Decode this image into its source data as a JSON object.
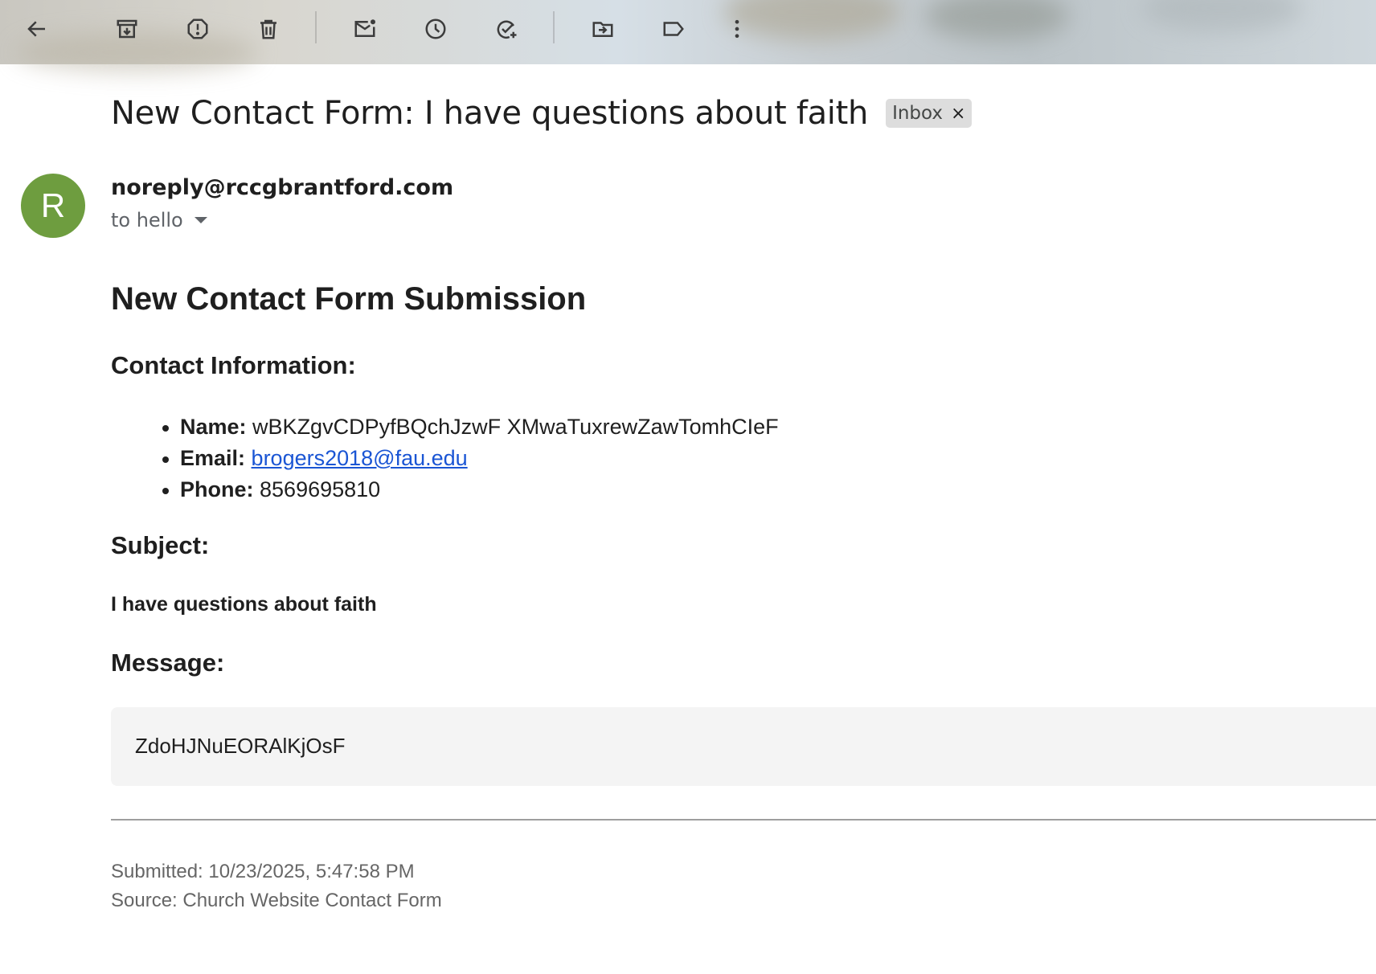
{
  "toolbar": {
    "icons": [
      "back-arrow-icon",
      "archive-icon",
      "report-spam-icon",
      "delete-icon",
      "mark-unread-icon",
      "snooze-icon",
      "add-task-icon",
      "move-to-icon",
      "label-icon",
      "more-vert-icon"
    ]
  },
  "email": {
    "subject": "New Contact Form: I have questions about faith",
    "label_chip": "Inbox",
    "label_remove": "×",
    "avatar_letter": "R",
    "avatar_color": "#6e9d3f",
    "sender": "noreply@rccgbrantford.com",
    "recipient": "to hello"
  },
  "content": {
    "heading": "New Contact Form Submission",
    "contact_heading": "Contact Information:",
    "contact": {
      "name_label": "Name:",
      "name_value": "wBKZgvCDPyfBQchJzwF XMwaTuxrewZawTomhCIeF",
      "email_label": "Email:",
      "email_value": "brogers2018@fau.edu",
      "phone_label": "Phone:",
      "phone_value": "8569695810"
    },
    "subject_heading": "Subject:",
    "subject_value": "I have questions about faith",
    "message_heading": "Message:",
    "message_value": "ZdoHJNuEORAlKjOsF",
    "submitted": "Submitted: 10/23/2025, 5:47:58 PM",
    "source": "Source: Church Website Contact Form"
  },
  "colors": {
    "link": "#1a55d4",
    "message_bg": "#f4f4f4"
  }
}
